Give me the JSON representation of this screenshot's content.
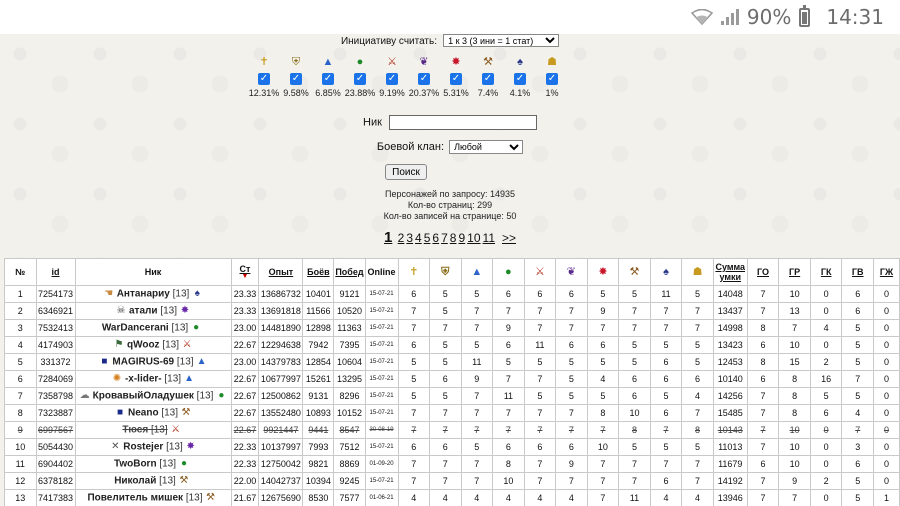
{
  "status": {
    "battery": "90%",
    "time": "14:31"
  },
  "initiative": {
    "label": "Инициативу считать:",
    "selected": "1 к 3 (3 ини = 1 стат)"
  },
  "stats": [
    {
      "icon": "cross-icon",
      "glyph": "✝",
      "color": "#c9a227",
      "pct": "12.31%"
    },
    {
      "icon": "shield-icon",
      "glyph": "⛨",
      "color": "#8a6d1a",
      "pct": "9.58%"
    },
    {
      "icon": "wizard-hat-icon",
      "glyph": "▲",
      "color": "#2a64c8",
      "pct": "6.85%"
    },
    {
      "icon": "drop-icon",
      "glyph": "●",
      "color": "#1f8a2a",
      "pct": "23.88%"
    },
    {
      "icon": "sword-icon",
      "glyph": "⚔",
      "color": "#b0331e",
      "pct": "9.19%"
    },
    {
      "icon": "dragon-icon",
      "glyph": "❦",
      "color": "#5a2a8a",
      "pct": "20.37%"
    },
    {
      "icon": "star-icon",
      "glyph": "✸",
      "color": "#c8172a",
      "pct": "5.31%"
    },
    {
      "icon": "hammer-icon",
      "glyph": "⚒",
      "color": "#8a5a20",
      "pct": "7.4%"
    },
    {
      "icon": "mask-icon",
      "glyph": "♠",
      "color": "#2a3a8a",
      "pct": "4.1%"
    },
    {
      "icon": "helmet-icon",
      "glyph": "☗",
      "color": "#c99a20",
      "pct": "1%"
    }
  ],
  "search_form": {
    "nik_label": "Ник",
    "clan_label": "Боевой клан:",
    "clan_selected": "Любой",
    "button": "Поиск"
  },
  "summary": {
    "line1": "Персонажей по запросу: 14935",
    "line2": "Кол-во страниц: 299",
    "line3": "Кол-во записей на странице: 50"
  },
  "pager": {
    "current": "1",
    "pages": [
      "2",
      "3",
      "4",
      "5",
      "6",
      "7",
      "8",
      "9",
      "10",
      "11"
    ],
    "next": ">>"
  },
  "table": {
    "headers": {
      "num": "№",
      "id": "id",
      "nik": "Ник",
      "st": "Ст",
      "exp": "Опыт",
      "fights": "Боёв",
      "wins": "Побед",
      "online": "Online",
      "sum_line1": "Сумма",
      "sum_line2": "умки",
      "go": "ГО",
      "gr": "ГР",
      "gk": "ГК",
      "gv": "ГВ",
      "gzh": "ГЖ"
    },
    "rows": [
      {
        "n": "1",
        "id": "7254173",
        "name": "Антанариу",
        "lvl": "[13]",
        "picon": "hand-icon",
        "pg": "☚",
        "pc": "#c98a40",
        "sicon": "mask-icon",
        "sg": "♠",
        "sc": "#2a3a8a",
        "st": "23.33",
        "exp": "13686732",
        "fights": "10401",
        "wins": "9121",
        "online": "15-07-21",
        "v": [
          "6",
          "5",
          "5",
          "6",
          "6",
          "6",
          "5",
          "5",
          "11",
          "5"
        ],
        "sum": "14048",
        "go": "7",
        "gr": "10",
        "gk": "0",
        "gv": "6",
        "gzh": "0"
      },
      {
        "n": "2",
        "id": "6346921",
        "name": "атали",
        "lvl": "[13]",
        "picon": "skull-icon",
        "pg": "☠",
        "pc": "#444",
        "sicon": "star-icon",
        "sg": "✸",
        "sc": "#6a2aa8",
        "st": "23.33",
        "exp": "13691818",
        "fights": "11566",
        "wins": "10520",
        "online": "15-07-21",
        "v": [
          "7",
          "5",
          "7",
          "7",
          "7",
          "7",
          "9",
          "7",
          "7",
          "7"
        ],
        "sum": "13437",
        "go": "7",
        "gr": "13",
        "gk": "0",
        "gv": "6",
        "gzh": "0"
      },
      {
        "n": "3",
        "id": "7532413",
        "name": "WarDancerani",
        "lvl": "[13]",
        "picon": "",
        "pg": "",
        "pc": "",
        "sicon": "drop-icon",
        "sg": "●",
        "sc": "#1f8a2a",
        "st": "23.00",
        "exp": "14481890",
        "fights": "12898",
        "wins": "11363",
        "online": "15-07-21",
        "v": [
          "7",
          "7",
          "7",
          "9",
          "7",
          "7",
          "7",
          "7",
          "7",
          "7"
        ],
        "sum": "14998",
        "go": "8",
        "gr": "7",
        "gk": "4",
        "gv": "5",
        "gzh": "0"
      },
      {
        "n": "4",
        "id": "4174903",
        "name": "qWooz",
        "lvl": "[13]",
        "picon": "flag-icon",
        "pg": "⚑",
        "pc": "#3a6a3a",
        "sicon": "sword-icon",
        "sg": "⚔",
        "sc": "#b0331e",
        "st": "22.67",
        "exp": "12294638",
        "fights": "7942",
        "wins": "7395",
        "online": "15-07-21",
        "v": [
          "6",
          "5",
          "5",
          "6",
          "11",
          "6",
          "6",
          "5",
          "5",
          "5"
        ],
        "sum": "13423",
        "go": "6",
        "gr": "10",
        "gk": "0",
        "gv": "5",
        "gzh": "0"
      },
      {
        "n": "5",
        "id": "331372",
        "name": "MAGIRUS-69",
        "lvl": "[13]",
        "picon": "banner-icon",
        "pg": "■",
        "pc": "#1a2a8a",
        "sicon": "wizard-hat-icon",
        "sg": "▲",
        "sc": "#2a64c8",
        "st": "23.00",
        "exp": "14379783",
        "fights": "12854",
        "wins": "10604",
        "online": "15-07-21",
        "v": [
          "5",
          "5",
          "11",
          "5",
          "5",
          "5",
          "5",
          "5",
          "6",
          "5"
        ],
        "sum": "12453",
        "go": "8",
        "gr": "15",
        "gk": "2",
        "gv": "5",
        "gzh": "0"
      },
      {
        "n": "6",
        "id": "7284069",
        "name": "-x-lider-",
        "lvl": "[13]",
        "picon": "sun-icon",
        "pg": "✺",
        "pc": "#d4801a",
        "sicon": "wizard-hat-icon",
        "sg": "▲",
        "sc": "#2a64c8",
        "st": "22.67",
        "exp": "10677997",
        "fights": "15261",
        "wins": "13295",
        "online": "15-07-21",
        "v": [
          "5",
          "6",
          "9",
          "7",
          "7",
          "5",
          "4",
          "6",
          "6",
          "6"
        ],
        "sum": "10140",
        "go": "6",
        "gr": "8",
        "gk": "16",
        "gv": "7",
        "gzh": "0"
      },
      {
        "n": "7",
        "id": "7358798",
        "name": "КровавыйОладушек",
        "lvl": "[13]",
        "picon": "cloud-icon",
        "pg": "☁",
        "pc": "#777",
        "sicon": "drop-icon",
        "sg": "●",
        "sc": "#1f8a2a",
        "st": "22.67",
        "exp": "12500862",
        "fights": "9131",
        "wins": "8296",
        "online": "15-07-21",
        "v": [
          "5",
          "5",
          "7",
          "11",
          "5",
          "5",
          "5",
          "6",
          "5",
          "4"
        ],
        "sum": "14256",
        "go": "7",
        "gr": "8",
        "gk": "5",
        "gv": "5",
        "gzh": "0"
      },
      {
        "n": "8",
        "id": "7323887",
        "name": "Neano",
        "lvl": "[13]",
        "picon": "banner-icon",
        "pg": "■",
        "pc": "#1a2a8a",
        "sicon": "hammer-icon",
        "sg": "⚒",
        "sc": "#8a5a20",
        "st": "22.67",
        "exp": "13552480",
        "fights": "10893",
        "wins": "10152",
        "online": "15-07-21",
        "v": [
          "7",
          "7",
          "7",
          "7",
          "7",
          "7",
          "8",
          "10",
          "6",
          "7"
        ],
        "sum": "15485",
        "go": "7",
        "gr": "8",
        "gk": "6",
        "gv": "4",
        "gzh": "0"
      },
      {
        "n": "9",
        "id": "6997567",
        "name": "Тюся",
        "lvl": "[13]",
        "picon": "",
        "pg": "",
        "pc": "",
        "sicon": "sword-icon",
        "sg": "⚔",
        "sc": "#b0331e",
        "st": "22.67",
        "exp": "9921447",
        "fights": "9441",
        "wins": "8547",
        "online": "30-08-19",
        "struck": true,
        "v": [
          "7",
          "7",
          "7",
          "7",
          "7",
          "7",
          "7",
          "8",
          "7",
          "8"
        ],
        "sum": "10143",
        "go": "7",
        "gr": "10",
        "gk": "0",
        "gv": "7",
        "gzh": "0"
      },
      {
        "n": "10",
        "id": "5054430",
        "name": "Rostejer",
        "lvl": "[13]",
        "picon": "swords-icon",
        "pg": "✕",
        "pc": "#555",
        "sicon": "star-icon",
        "sg": "✸",
        "sc": "#6a2aa8",
        "st": "22.33",
        "exp": "10137997",
        "fights": "7993",
        "wins": "7512",
        "online": "15-07-21",
        "v": [
          "6",
          "6",
          "5",
          "6",
          "6",
          "6",
          "10",
          "5",
          "5",
          "5"
        ],
        "sum": "11013",
        "go": "7",
        "gr": "10",
        "gk": "0",
        "gv": "3",
        "gzh": "0"
      },
      {
        "n": "11",
        "id": "6904402",
        "name": "TwoBorn",
        "lvl": "[13]",
        "picon": "",
        "pg": "",
        "pc": "",
        "sicon": "drop-icon",
        "sg": "●",
        "sc": "#1f8a2a",
        "st": "22.33",
        "exp": "12750042",
        "fights": "9821",
        "wins": "8869",
        "online": "01-09-20",
        "v": [
          "7",
          "7",
          "7",
          "8",
          "7",
          "9",
          "7",
          "7",
          "7",
          "7"
        ],
        "sum": "11679",
        "go": "6",
        "gr": "10",
        "gk": "0",
        "gv": "6",
        "gzh": "0"
      },
      {
        "n": "12",
        "id": "6378182",
        "name": "Николай",
        "lvl": "[13]",
        "picon": "",
        "pg": "",
        "pc": "",
        "sicon": "hammer-icon",
        "sg": "⚒",
        "sc": "#8a5a20",
        "st": "22.00",
        "exp": "14042737",
        "fights": "10394",
        "wins": "9245",
        "online": "15-07-21",
        "v": [
          "7",
          "7",
          "7",
          "10",
          "7",
          "7",
          "7",
          "7",
          "6",
          "7"
        ],
        "sum": "14192",
        "go": "7",
        "gr": "9",
        "gk": "2",
        "gv": "5",
        "gzh": "0"
      },
      {
        "n": "13",
        "id": "7417383",
        "name": "Повелитель мишек",
        "lvl": "[13]",
        "picon": "",
        "pg": "",
        "pc": "",
        "sicon": "hammer-icon",
        "sg": "⚒",
        "sc": "#8a5a20",
        "st": "21.67",
        "exp": "12675690",
        "fights": "8530",
        "wins": "7577",
        "online": "01-06-21",
        "v": [
          "4",
          "4",
          "4",
          "4",
          "4",
          "4",
          "7",
          "11",
          "4",
          "4"
        ],
        "sum": "13946",
        "go": "7",
        "gr": "7",
        "gk": "0",
        "gv": "5",
        "gzh": "1"
      }
    ]
  }
}
